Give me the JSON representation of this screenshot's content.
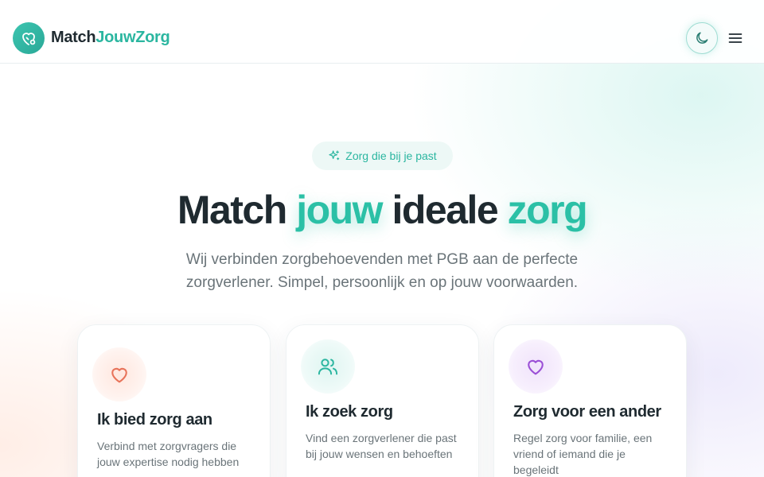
{
  "header": {
    "logo_part1": "Match",
    "logo_part2": "JouwZorg",
    "theme_toggle_icon": "moon-icon",
    "menu_icon": "hamburger-menu-icon",
    "colors": {
      "brand": "#2bb6a0",
      "text": "#1f2a30"
    }
  },
  "hero": {
    "badge_icon": "sparkles-icon",
    "badge_label": "Zorg die bij je past",
    "title_word1": "Match",
    "title_word2": "jouw",
    "title_word3": "ideale",
    "title_word4": "zorg",
    "subtitle": "Wij verbinden zorgbehoevenden met PGB aan de perfecte zorgverlener. Simpel, persoonlijk en op jouw voorwaarden."
  },
  "cards": [
    {
      "icon": "heart-icon",
      "icon_color": "#e8735a",
      "title": "Ik bied zorg aan",
      "description": "Verbind met zorgvragers die jouw expertise nodig hebben"
    },
    {
      "icon": "users-icon",
      "icon_color": "#2bb6a0",
      "title": "Ik zoek zorg",
      "description": "Vind een zorgverlener die past bij jouw wensen en behoeften"
    },
    {
      "icon": "heart-icon",
      "icon_color": "#9b4fd6",
      "title": "Zorg voor een ander",
      "description": "Regel zorg voor familie, een vriend of iemand die je begeleidt"
    }
  ]
}
